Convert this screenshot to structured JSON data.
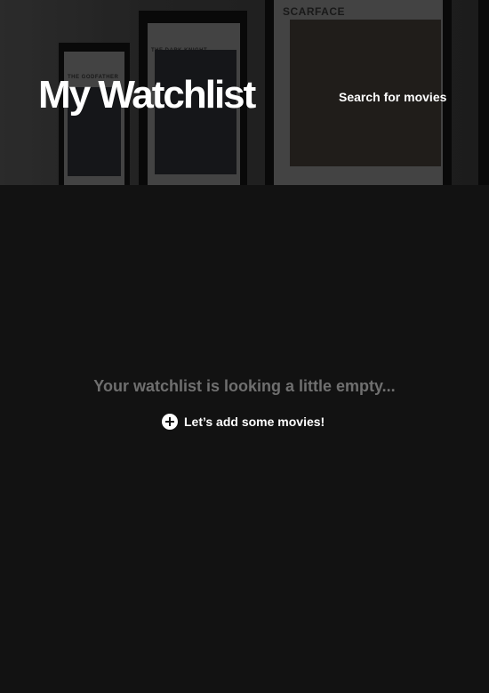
{
  "header": {
    "title": "My Watchlist",
    "search_link": "Search for movies",
    "posters": [
      "THE GODFATHER",
      "THE DARK KNIGHT",
      "SCARFACE"
    ]
  },
  "main": {
    "empty_message": "Your watchlist is looking a little empty...",
    "add_label": "Let’s add some movies!",
    "add_icon": "plus-circle-icon"
  },
  "colors": {
    "background": "#121212",
    "muted_text": "#6f6f6f",
    "text": "#ffffff"
  }
}
